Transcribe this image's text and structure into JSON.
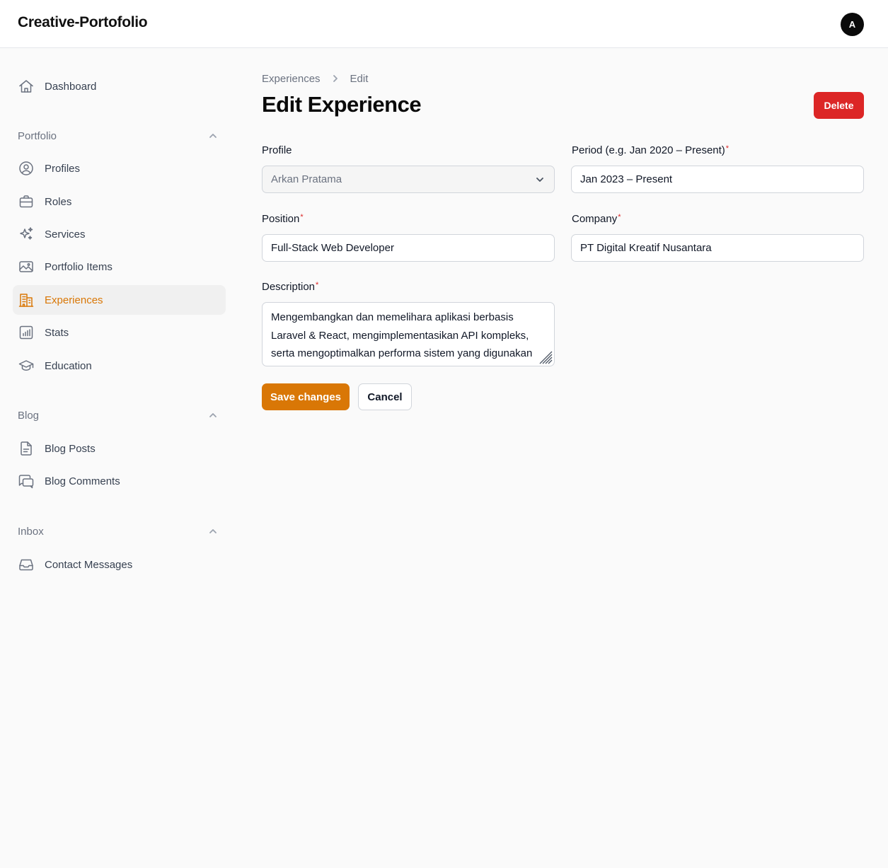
{
  "app": {
    "brand": "Creative-Portofolio",
    "avatar_initial": "A"
  },
  "sidebar": {
    "dashboard": "Dashboard",
    "groups": [
      {
        "label": "Portfolio",
        "items": [
          "Profiles",
          "Roles",
          "Services",
          "Portfolio Items",
          "Experiences",
          "Stats",
          "Education"
        ]
      },
      {
        "label": "Blog",
        "items": [
          "Blog Posts",
          "Blog Comments"
        ]
      },
      {
        "label": "Inbox",
        "items": [
          "Contact Messages"
        ]
      }
    ],
    "active_item": "Experiences"
  },
  "breadcrumb": {
    "parent": "Experiences",
    "current": "Edit"
  },
  "page": {
    "title": "Edit Experience",
    "delete_label": "Delete"
  },
  "form": {
    "profile": {
      "label": "Profile",
      "value": "Arkan Pratama"
    },
    "period": {
      "label": "Period (e.g. Jan 2020 – Present)",
      "value": "Jan 2023 – Present",
      "required_mark": "*"
    },
    "position": {
      "label": "Position",
      "value": "Full-Stack Web Developer",
      "required_mark": "*"
    },
    "company": {
      "label": "Company",
      "value": "PT Digital Kreatif Nusantara",
      "required_mark": "*"
    },
    "description": {
      "label": "Description",
      "required_mark": "*",
      "value": "Mengembangkan dan memelihara aplikasi berbasis Laravel & React, mengimplementasikan API kompleks, serta mengoptimalkan performa sistem yang digunakan"
    },
    "save_label": "Save changes",
    "cancel_label": "Cancel"
  },
  "colors": {
    "accent": "#d97706",
    "danger": "#dc2626",
    "background": "#fafafa"
  }
}
